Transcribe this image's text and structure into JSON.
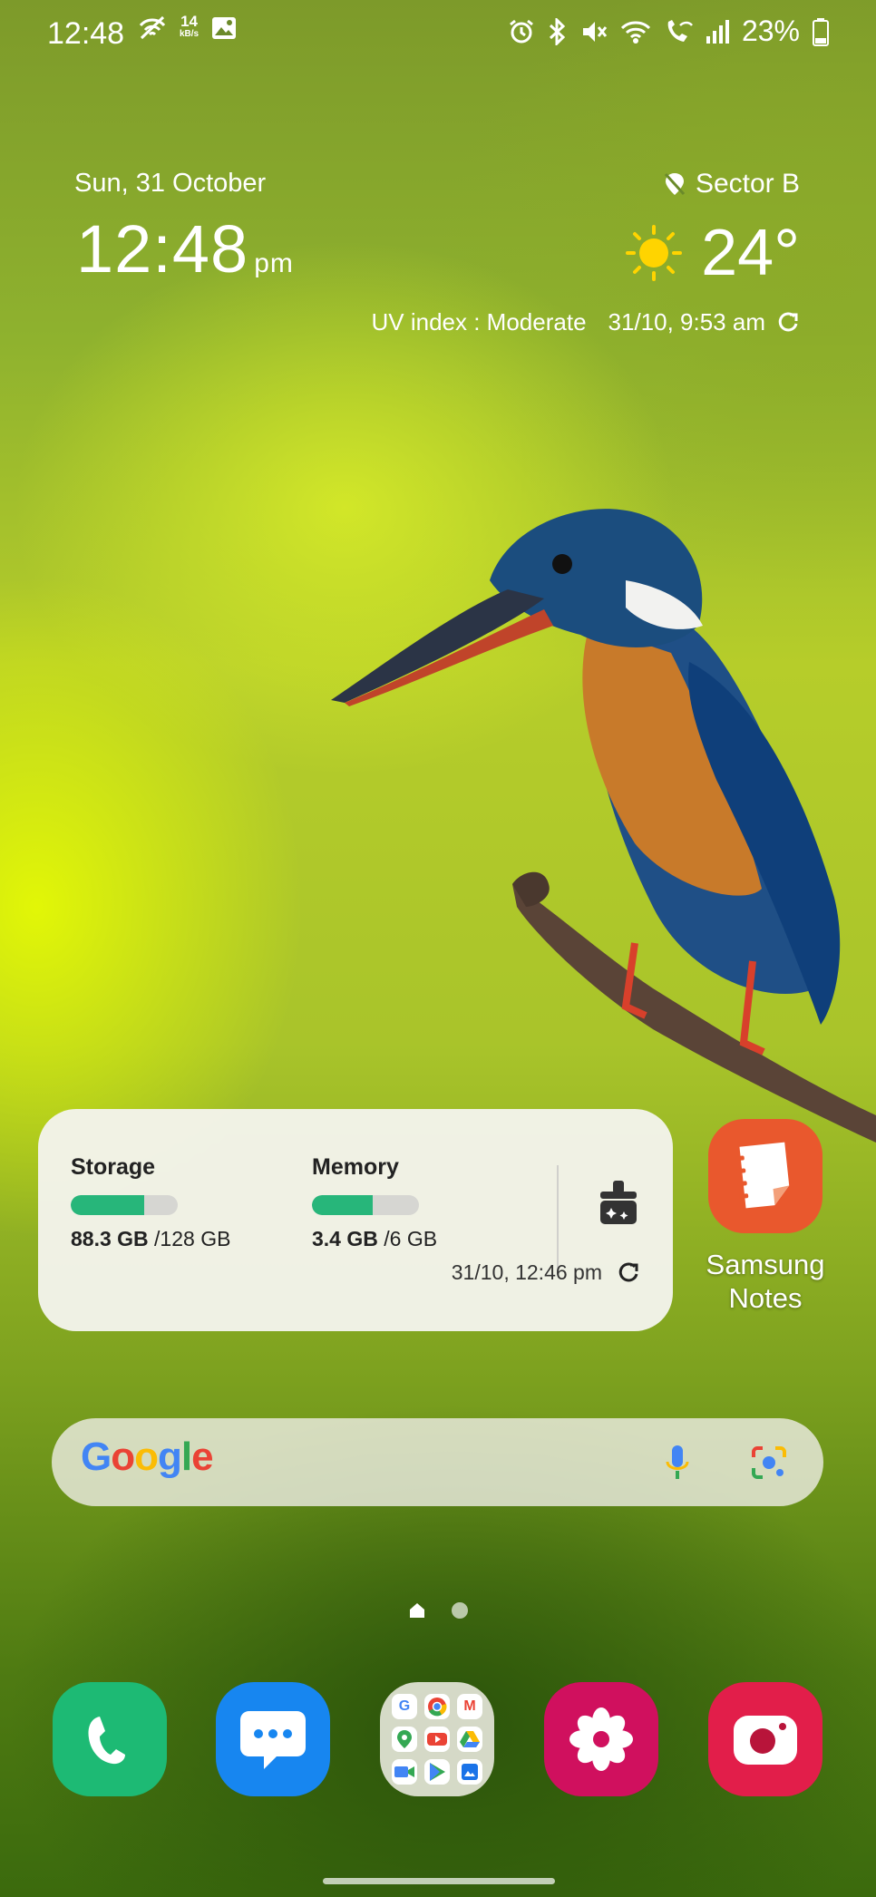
{
  "status_bar": {
    "time": "12:48",
    "net_speed": "14",
    "net_unit": "kB/s",
    "battery": "23%",
    "left_icons": [
      "wifi-off-icon",
      "net-speed-icon",
      "image-icon"
    ],
    "right_icons": [
      "alarm-icon",
      "bluetooth-icon",
      "mute-icon",
      "wifi-icon",
      "wifi-calling-icon",
      "signal-icon",
      "battery-icon"
    ]
  },
  "clock_widget": {
    "date": "Sun, 31 October",
    "time": "12:48",
    "ampm": "pm"
  },
  "weather_widget": {
    "location": "Sector B",
    "temperature": "24°",
    "uv": "UV index : Moderate",
    "updated": "31/10, 9:53 am",
    "icons": [
      "location-icon",
      "sun-icon",
      "refresh-icon"
    ]
  },
  "device_care": {
    "storage_label": "Storage",
    "storage_used": "88.3 GB",
    "storage_total": "/128 GB",
    "storage_fraction": 0.69,
    "memory_label": "Memory",
    "memory_used": "3.4 GB",
    "memory_total": "/6 GB",
    "memory_fraction": 0.57,
    "updated": "31/10, 12:46 pm",
    "colors": {
      "bar_fill": "#27b67a",
      "bar_track": "#d6d6d2"
    }
  },
  "apps": {
    "samsung_notes": "Samsung Notes",
    "dock": [
      "phone-icon",
      "messages-icon",
      "google-folder-icon",
      "gallery-icon",
      "camera-icon"
    ]
  },
  "search": {
    "logo": "Google",
    "colors": {
      "blue": "#4285F4",
      "red": "#EA4335",
      "yellow": "#FBBC05",
      "green": "#34A853"
    }
  },
  "pages": {
    "current": 1,
    "total": 2
  }
}
